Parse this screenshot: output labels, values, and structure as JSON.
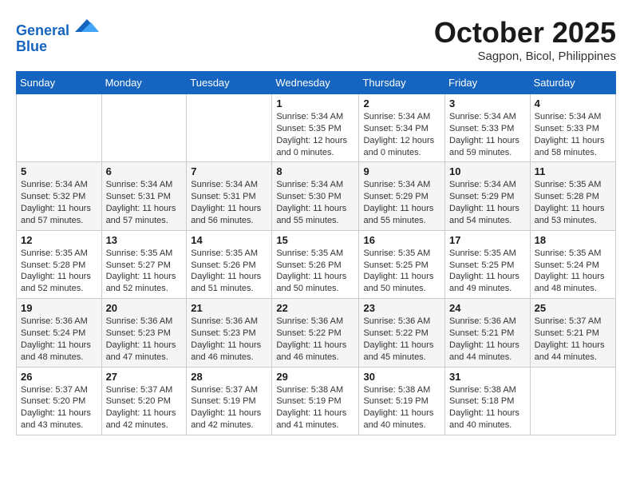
{
  "header": {
    "logo_line1": "General",
    "logo_line2": "Blue",
    "month": "October 2025",
    "location": "Sagpon, Bicol, Philippines"
  },
  "weekdays": [
    "Sunday",
    "Monday",
    "Tuesday",
    "Wednesday",
    "Thursday",
    "Friday",
    "Saturday"
  ],
  "weeks": [
    [
      {
        "day": "",
        "info": ""
      },
      {
        "day": "",
        "info": ""
      },
      {
        "day": "",
        "info": ""
      },
      {
        "day": "1",
        "info": "Sunrise: 5:34 AM\nSunset: 5:35 PM\nDaylight: 12 hours\nand 0 minutes."
      },
      {
        "day": "2",
        "info": "Sunrise: 5:34 AM\nSunset: 5:34 PM\nDaylight: 12 hours\nand 0 minutes."
      },
      {
        "day": "3",
        "info": "Sunrise: 5:34 AM\nSunset: 5:33 PM\nDaylight: 11 hours\nand 59 minutes."
      },
      {
        "day": "4",
        "info": "Sunrise: 5:34 AM\nSunset: 5:33 PM\nDaylight: 11 hours\nand 58 minutes."
      }
    ],
    [
      {
        "day": "5",
        "info": "Sunrise: 5:34 AM\nSunset: 5:32 PM\nDaylight: 11 hours\nand 57 minutes."
      },
      {
        "day": "6",
        "info": "Sunrise: 5:34 AM\nSunset: 5:31 PM\nDaylight: 11 hours\nand 57 minutes."
      },
      {
        "day": "7",
        "info": "Sunrise: 5:34 AM\nSunset: 5:31 PM\nDaylight: 11 hours\nand 56 minutes."
      },
      {
        "day": "8",
        "info": "Sunrise: 5:34 AM\nSunset: 5:30 PM\nDaylight: 11 hours\nand 55 minutes."
      },
      {
        "day": "9",
        "info": "Sunrise: 5:34 AM\nSunset: 5:29 PM\nDaylight: 11 hours\nand 55 minutes."
      },
      {
        "day": "10",
        "info": "Sunrise: 5:34 AM\nSunset: 5:29 PM\nDaylight: 11 hours\nand 54 minutes."
      },
      {
        "day": "11",
        "info": "Sunrise: 5:35 AM\nSunset: 5:28 PM\nDaylight: 11 hours\nand 53 minutes."
      }
    ],
    [
      {
        "day": "12",
        "info": "Sunrise: 5:35 AM\nSunset: 5:28 PM\nDaylight: 11 hours\nand 52 minutes."
      },
      {
        "day": "13",
        "info": "Sunrise: 5:35 AM\nSunset: 5:27 PM\nDaylight: 11 hours\nand 52 minutes."
      },
      {
        "day": "14",
        "info": "Sunrise: 5:35 AM\nSunset: 5:26 PM\nDaylight: 11 hours\nand 51 minutes."
      },
      {
        "day": "15",
        "info": "Sunrise: 5:35 AM\nSunset: 5:26 PM\nDaylight: 11 hours\nand 50 minutes."
      },
      {
        "day": "16",
        "info": "Sunrise: 5:35 AM\nSunset: 5:25 PM\nDaylight: 11 hours\nand 50 minutes."
      },
      {
        "day": "17",
        "info": "Sunrise: 5:35 AM\nSunset: 5:25 PM\nDaylight: 11 hours\nand 49 minutes."
      },
      {
        "day": "18",
        "info": "Sunrise: 5:35 AM\nSunset: 5:24 PM\nDaylight: 11 hours\nand 48 minutes."
      }
    ],
    [
      {
        "day": "19",
        "info": "Sunrise: 5:36 AM\nSunset: 5:24 PM\nDaylight: 11 hours\nand 48 minutes."
      },
      {
        "day": "20",
        "info": "Sunrise: 5:36 AM\nSunset: 5:23 PM\nDaylight: 11 hours\nand 47 minutes."
      },
      {
        "day": "21",
        "info": "Sunrise: 5:36 AM\nSunset: 5:23 PM\nDaylight: 11 hours\nand 46 minutes."
      },
      {
        "day": "22",
        "info": "Sunrise: 5:36 AM\nSunset: 5:22 PM\nDaylight: 11 hours\nand 46 minutes."
      },
      {
        "day": "23",
        "info": "Sunrise: 5:36 AM\nSunset: 5:22 PM\nDaylight: 11 hours\nand 45 minutes."
      },
      {
        "day": "24",
        "info": "Sunrise: 5:36 AM\nSunset: 5:21 PM\nDaylight: 11 hours\nand 44 minutes."
      },
      {
        "day": "25",
        "info": "Sunrise: 5:37 AM\nSunset: 5:21 PM\nDaylight: 11 hours\nand 44 minutes."
      }
    ],
    [
      {
        "day": "26",
        "info": "Sunrise: 5:37 AM\nSunset: 5:20 PM\nDaylight: 11 hours\nand 43 minutes."
      },
      {
        "day": "27",
        "info": "Sunrise: 5:37 AM\nSunset: 5:20 PM\nDaylight: 11 hours\nand 42 minutes."
      },
      {
        "day": "28",
        "info": "Sunrise: 5:37 AM\nSunset: 5:19 PM\nDaylight: 11 hours\nand 42 minutes."
      },
      {
        "day": "29",
        "info": "Sunrise: 5:38 AM\nSunset: 5:19 PM\nDaylight: 11 hours\nand 41 minutes."
      },
      {
        "day": "30",
        "info": "Sunrise: 5:38 AM\nSunset: 5:19 PM\nDaylight: 11 hours\nand 40 minutes."
      },
      {
        "day": "31",
        "info": "Sunrise: 5:38 AM\nSunset: 5:18 PM\nDaylight: 11 hours\nand 40 minutes."
      },
      {
        "day": "",
        "info": ""
      }
    ]
  ]
}
